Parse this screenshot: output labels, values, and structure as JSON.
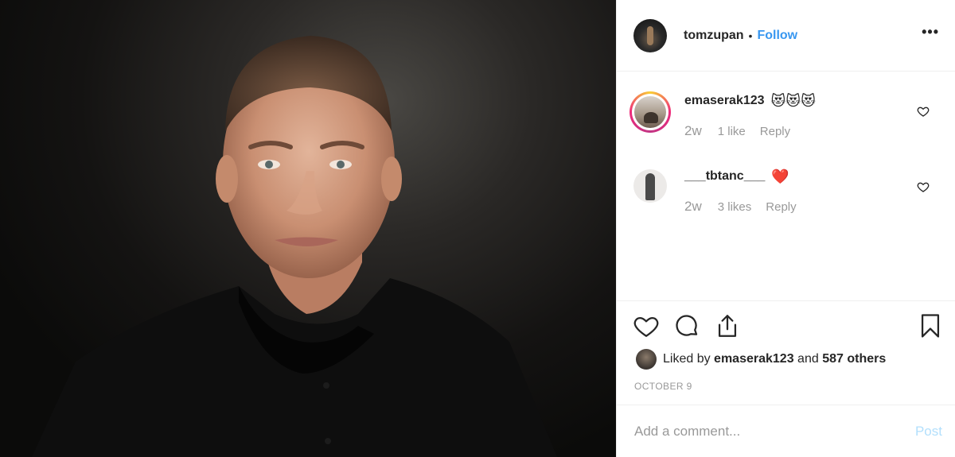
{
  "post": {
    "username": "tomzupan",
    "separator": "•",
    "follow_label": "Follow",
    "more_label": "•••"
  },
  "comments": [
    {
      "username": "emaserak123",
      "text": "😻😻😻",
      "time": "2w",
      "likes": "1 like",
      "reply_label": "Reply"
    },
    {
      "username": "___tbtanc___",
      "text": "❤️",
      "time": "2w",
      "likes": "3 likes",
      "reply_label": "Reply"
    }
  ],
  "actions": {
    "like_icon": "heart-outline-icon",
    "comment_icon": "comment-bubble-icon",
    "share_icon": "share-upload-icon",
    "save_icon": "bookmark-icon"
  },
  "liked_by": {
    "prefix": "Liked by",
    "user": "emaserak123",
    "conjunction": "and",
    "others": "587 others"
  },
  "date": "OCTOBER 9",
  "add_comment": {
    "placeholder": "Add a comment...",
    "post_label": "Post"
  },
  "colors": {
    "accent": "#3897f0",
    "muted": "#999999",
    "post_disabled": "#b2dffc",
    "heart_red": "#ed4956"
  }
}
